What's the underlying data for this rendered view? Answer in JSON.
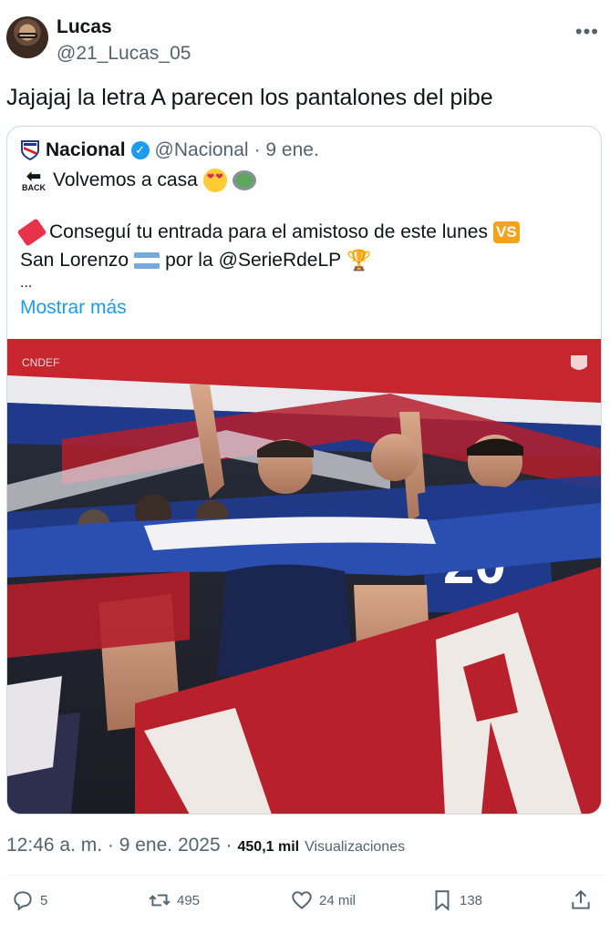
{
  "tweet": {
    "author_name": "Lucas",
    "author_handle": "@21_Lucas_05",
    "text": "Jajajaj la letra A parecen los pantalones del pibe",
    "timestamp": "12:46 a. m. · 9 ene. 2025 ·",
    "views_count": "450,1 mil",
    "views_label": "Visualizaciones"
  },
  "quote": {
    "author_name": "Nacional",
    "author_handle": "@Nacional",
    "date": "· 9 ene.",
    "back_label": "BACK",
    "line1": "Volvemos a casa",
    "line2": "Conseguí tu entrada para el amistoso de este lunes",
    "vs_label": "VS",
    "line3_a": "San Lorenzo",
    "line3_b": "por la",
    "mention": "@SerieRdeLP",
    "ellipsis": "...",
    "show_more": "Mostrar más",
    "photo_watermark": "CNDEF"
  },
  "actions": {
    "replies": "5",
    "retweets": "495",
    "likes": "24 mil",
    "bookmarks": "138"
  },
  "icons": [
    "more-icon",
    "verified-icon",
    "back-icon",
    "heart-eyes-icon",
    "stadium-icon",
    "ticket-icon",
    "argentina-flag-icon",
    "trophy-icon",
    "reply-icon",
    "retweet-icon",
    "like-icon",
    "bookmark-icon",
    "share-icon"
  ],
  "colors": {
    "accent": "#1d9bf0",
    "muted": "#536471",
    "club_red": "#c8262f",
    "club_blue": "#1f3a8a"
  }
}
